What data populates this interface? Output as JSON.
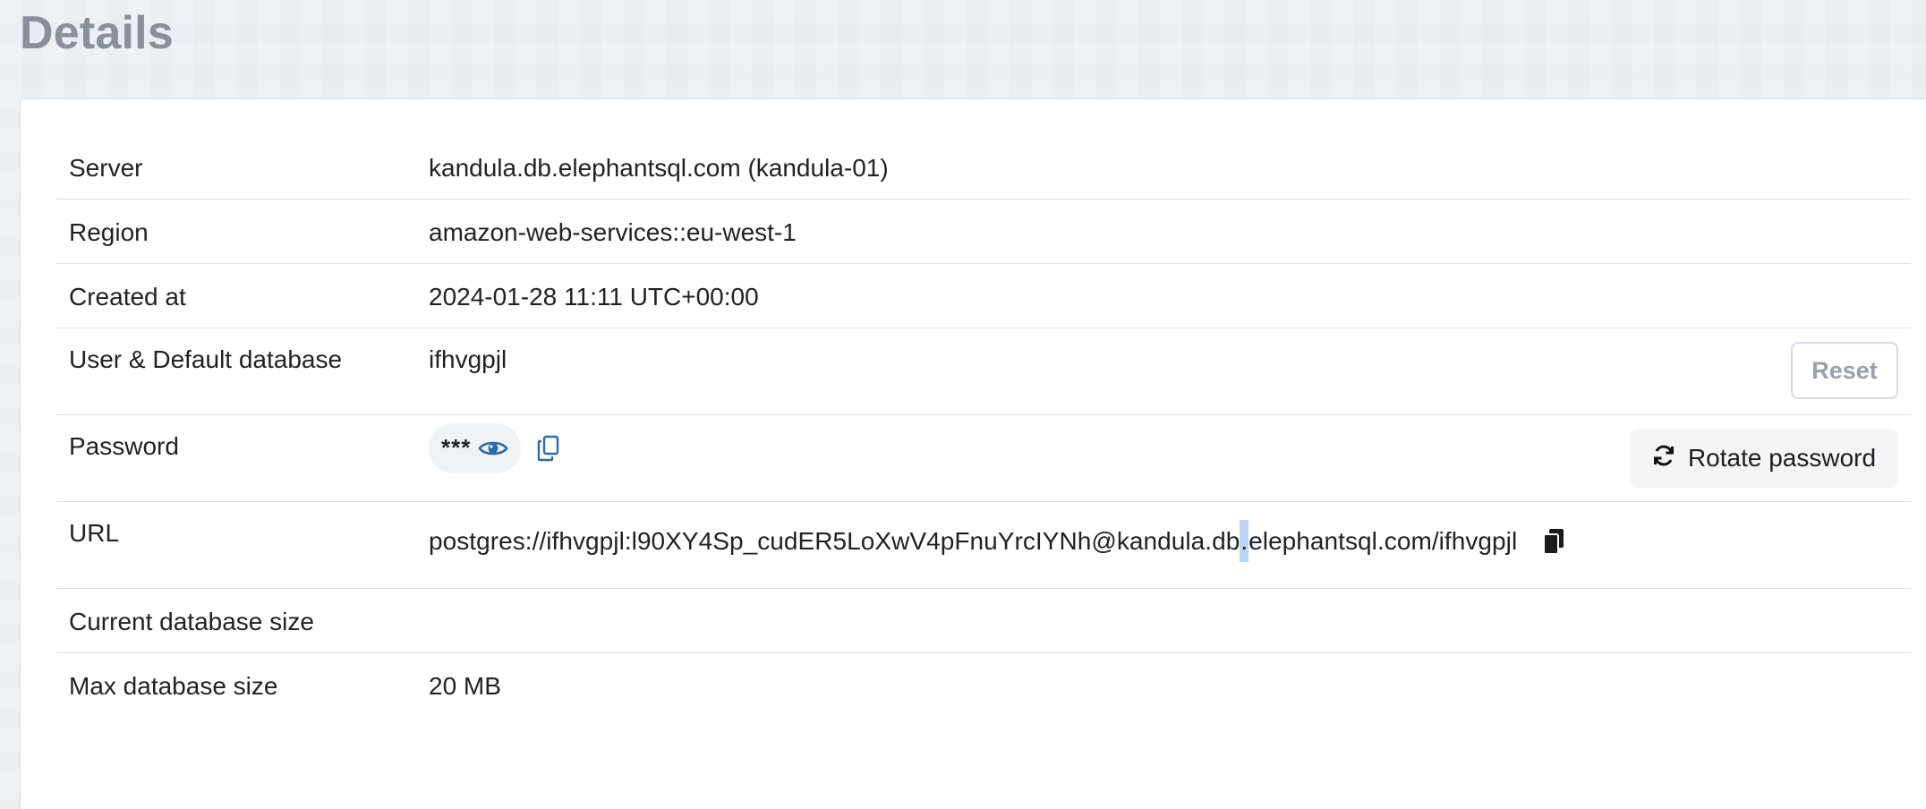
{
  "page": {
    "title": "Details"
  },
  "details": {
    "server": {
      "label": "Server",
      "value": "kandula.db.elephantsql.com (kandula-01)"
    },
    "region": {
      "label": "Region",
      "value": "amazon-web-services::eu-west-1"
    },
    "created_at": {
      "label": "Created at",
      "value": "2024-01-28 11:11 UTC+00:00"
    },
    "user": {
      "label": "User & Default database",
      "value": "ifhvgpjl",
      "reset_label": "Reset"
    },
    "password": {
      "label": "Password",
      "masked_value": "***",
      "rotate_label": "Rotate password",
      "show_icon": "eye-icon",
      "copy_icon": "copy-outline-icon",
      "rotate_icon": "refresh-icon"
    },
    "url": {
      "label": "URL",
      "value_before_selection": "postgres://ifhvgpjl:l90XY4Sp_cudER5LoXwV4pFnuYrcIYNh@kandula.db",
      "value_selected": ".",
      "value_after_selection": "elephantsql.com/ifhvgpjl",
      "copy_icon": "copy-solid-icon"
    },
    "current_db_size": {
      "label": "Current database size",
      "value": ""
    },
    "max_db_size": {
      "label": "Max database size",
      "value": "20 MB"
    }
  },
  "colors": {
    "title": "#8a9099",
    "accent_icon": "#2d6aa8",
    "selection": "#b9d4f5"
  }
}
